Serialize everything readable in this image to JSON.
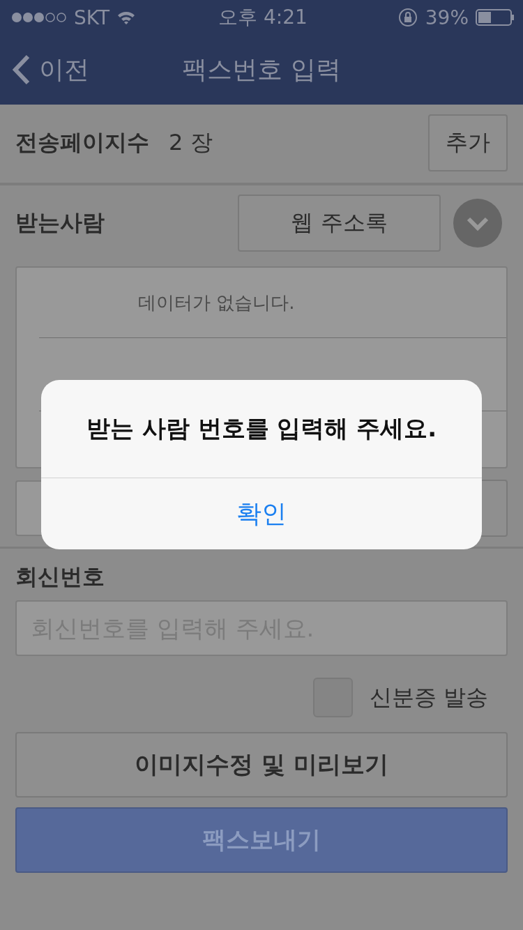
{
  "status_bar": {
    "carrier": "SKT",
    "time": "오후 4:21",
    "battery": "39%"
  },
  "nav": {
    "back": "이전",
    "title": "팩스번호 입력"
  },
  "pages": {
    "label": "전송페이지수",
    "value": "2 장",
    "add_button": "추가"
  },
  "recipient": {
    "label": "받는사람",
    "address_book_button": "웹 주소록",
    "empty_text": "데이터가 없습니다."
  },
  "reply": {
    "label": "회신번호",
    "placeholder": "회신번호를 입력해 주세요."
  },
  "id_card": {
    "label": "신분증 발송",
    "checked": false
  },
  "preview_button": "이미지수정 및 미리보기",
  "send_button": "팩스보내기",
  "alert": {
    "message": "받는 사람 번호를 입력해 주세요.",
    "confirm": "확인"
  }
}
